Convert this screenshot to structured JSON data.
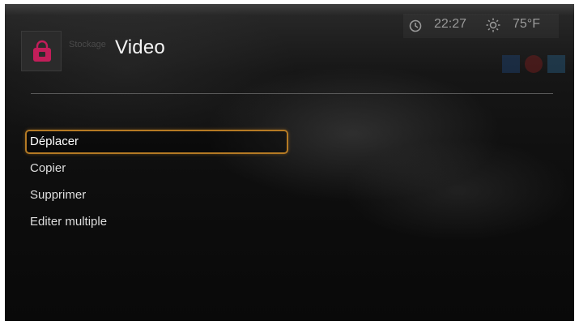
{
  "header": {
    "breadcrumb": "Stockage",
    "title": "Video",
    "app_icon": "storage-bag-icon"
  },
  "status": {
    "time": "22:27",
    "temperature": "75°F",
    "clock_icon": "clock-icon",
    "weather_icon": "sun-icon"
  },
  "menu": {
    "items": [
      {
        "label": "Déplacer",
        "selected": true
      },
      {
        "label": "Copier",
        "selected": false
      },
      {
        "label": "Supprimer",
        "selected": false
      },
      {
        "label": "Editer multiple",
        "selected": false
      }
    ]
  },
  "colors": {
    "selection_border": "#b57a24",
    "app_icon_accent": "#c21e5a",
    "text": "#dedede",
    "status_text": "#9a9a9a"
  }
}
